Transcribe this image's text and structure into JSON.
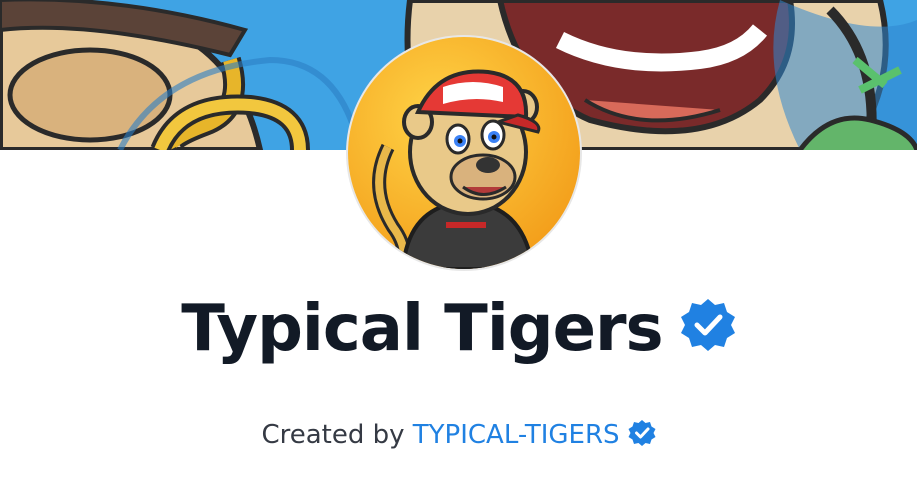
{
  "collection": {
    "title": "Typical Tigers",
    "created_by_label": "Created by",
    "creator_name": "TYPICAL-TIGERS"
  },
  "banner": {
    "description_icon": "banner-illustration"
  },
  "avatar": {
    "icon": "tiger-avatar"
  },
  "icons": {
    "verified": "verified-badge-icon"
  },
  "colors": {
    "title_text": "#121a26",
    "link": "#2081e2",
    "verified_badge": "#2081e2",
    "banner_sky": "#3fa3e4",
    "avatar_bg": "#f7b21d"
  }
}
